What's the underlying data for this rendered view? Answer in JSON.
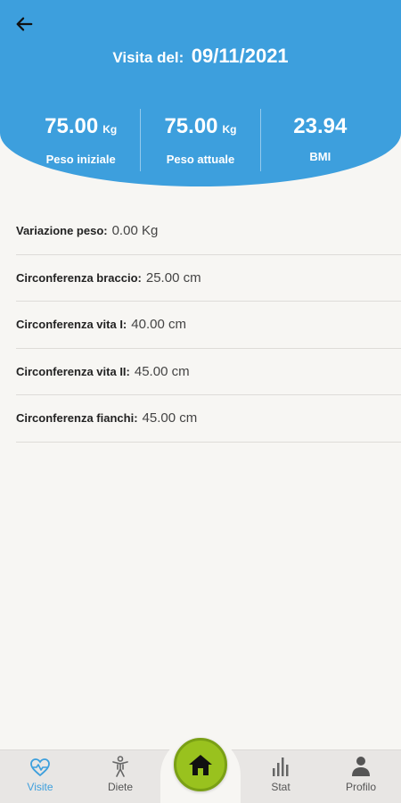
{
  "header": {
    "visit_label": "Visita del:",
    "visit_date": "09/11/2021",
    "stats": [
      {
        "value": "75.00",
        "unit": "Kg",
        "caption": "Peso iniziale"
      },
      {
        "value": "75.00",
        "unit": "Kg",
        "caption": "Peso attuale"
      },
      {
        "value": "23.94",
        "unit": "",
        "caption": "BMI"
      }
    ]
  },
  "details": [
    {
      "label": "Variazione peso:",
      "value": "0.00 Kg"
    },
    {
      "label": "Circonferenza braccio:",
      "value": "25.00 cm"
    },
    {
      "label": "Circonferenza vita I:",
      "value": "40.00 cm"
    },
    {
      "label": "Circonferenza vita II:",
      "value": "45.00 cm"
    },
    {
      "label": "Circonferenza fianchi:",
      "value": "45.00 cm"
    }
  ],
  "nav": {
    "items": [
      {
        "label": "Visite",
        "icon": "heart-pulse-icon"
      },
      {
        "label": "Diete",
        "icon": "body-icon"
      },
      {
        "label": "Stat",
        "icon": "bar-chart-icon"
      },
      {
        "label": "Profilo",
        "icon": "person-icon"
      }
    ],
    "home_icon": "home-icon",
    "active_color": "#3d9fdd",
    "home_color": "#99c21e"
  },
  "colors": {
    "header_bg": "#3d9fdd",
    "page_bg": "#f7f6f3"
  }
}
